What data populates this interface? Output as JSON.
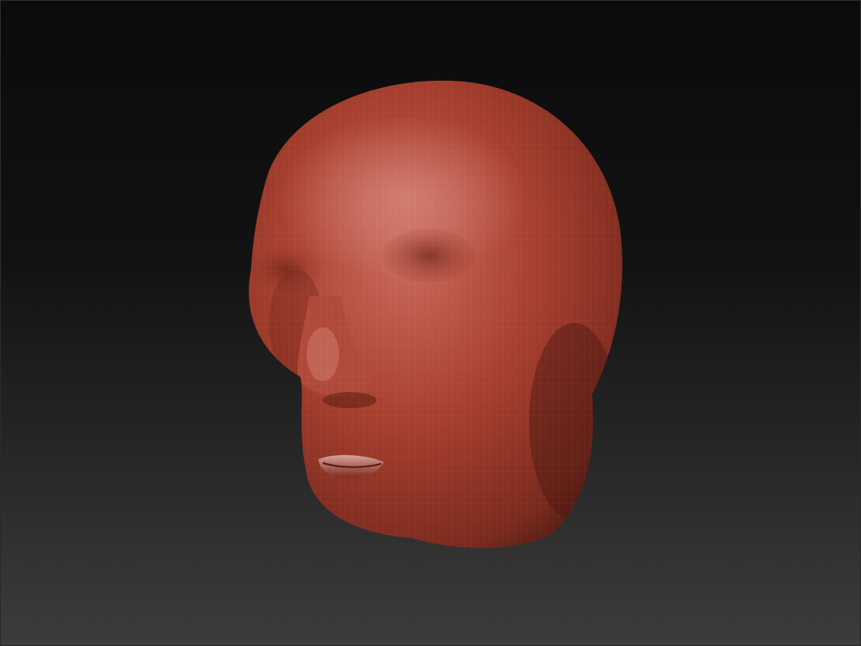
{
  "viewport": {
    "background_top": "#0b0b0b",
    "background_bottom": "#3c3c3c"
  },
  "model": {
    "subject": "sculpted-head-mesh",
    "material_color": "#a9402f",
    "material_highlight": "#d7857a",
    "material_shadow": "#4a1710",
    "wireframe": true
  }
}
